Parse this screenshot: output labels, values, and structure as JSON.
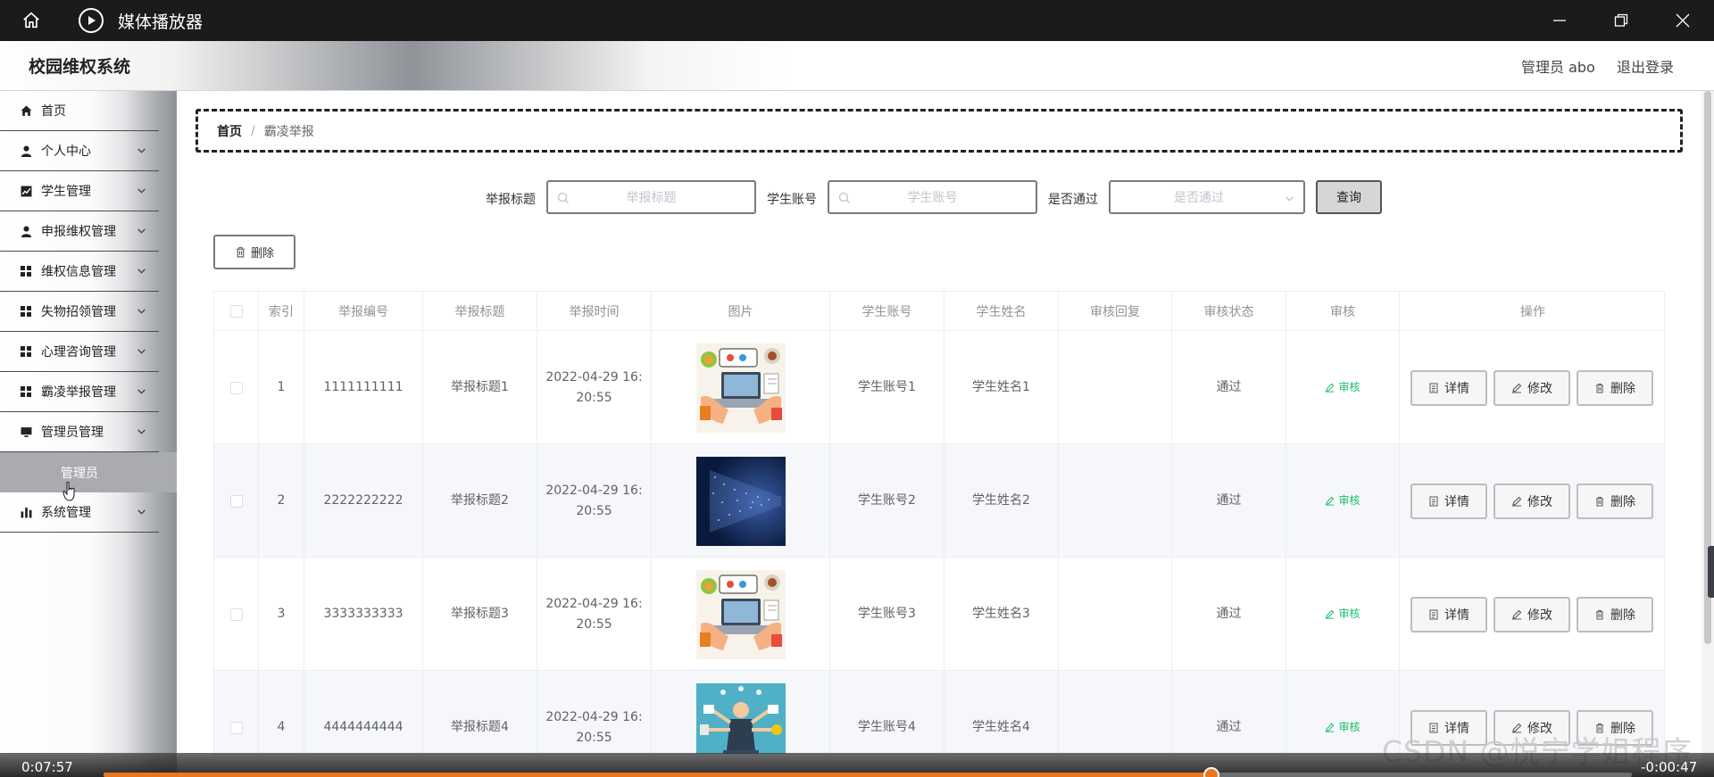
{
  "window": {
    "title": "媒体播放器"
  },
  "header": {
    "system_title": "校园维权系统",
    "admin_label": "管理员 abo",
    "logout_label": "退出登录"
  },
  "sidebar": {
    "items": [
      {
        "label": "首页",
        "icon": "home-icon",
        "expandable": false
      },
      {
        "label": "个人中心",
        "icon": "person-icon",
        "expandable": true
      },
      {
        "label": "学生管理",
        "icon": "chart-icon",
        "expandable": true
      },
      {
        "label": "申报维权管理",
        "icon": "person-icon",
        "expandable": true
      },
      {
        "label": "维权信息管理",
        "icon": "grid-icon",
        "expandable": true
      },
      {
        "label": "失物招领管理",
        "icon": "grid-icon",
        "expandable": true
      },
      {
        "label": "心理咨询管理",
        "icon": "grid-icon",
        "expandable": true
      },
      {
        "label": "霸凌举报管理",
        "icon": "grid-icon",
        "expandable": true
      },
      {
        "label": "管理员管理",
        "icon": "monitor-icon",
        "expandable": true
      },
      {
        "label": "系统管理",
        "icon": "bar-chart-icon",
        "expandable": true
      }
    ],
    "active_subitem": "管理员"
  },
  "breadcrumb": {
    "home": "首页",
    "separator": "/",
    "current": "霸凌举报"
  },
  "search": {
    "title_label": "举报标题",
    "title_placeholder": "举报标题",
    "account_label": "学生账号",
    "account_placeholder": "学生账号",
    "passed_label": "是否通过",
    "passed_placeholder": "是否通过",
    "query_button": "查询"
  },
  "toolbar": {
    "delete_label": "删除"
  },
  "table": {
    "columns": [
      "索引",
      "举报编号",
      "举报标题",
      "举报时间",
      "图片",
      "学生账号",
      "学生姓名",
      "审核回复",
      "审核状态",
      "审核",
      "操作"
    ],
    "rows": [
      {
        "index": "1",
        "number": "1111111111",
        "title": "举报标题1",
        "time_line1": "2022-04-29 16:",
        "time_line2": "20:55",
        "image": "office-illustration",
        "account": "学生账号1",
        "name": "学生姓名1",
        "reply": "",
        "status": "通过"
      },
      {
        "index": "2",
        "number": "2222222222",
        "title": "举报标题2",
        "time_line1": "2022-04-29 16:",
        "time_line2": "20:55",
        "image": "digital-data-image",
        "account": "学生账号2",
        "name": "学生姓名2",
        "reply": "",
        "status": "通过"
      },
      {
        "index": "3",
        "number": "3333333333",
        "title": "举报标题3",
        "time_line1": "2022-04-29 16:",
        "time_line2": "20:55",
        "image": "office-illustration",
        "account": "学生账号3",
        "name": "学生姓名3",
        "reply": "",
        "status": "通过"
      },
      {
        "index": "4",
        "number": "4444444444",
        "title": "举报标题4",
        "time_line1": "2022-04-29 16:",
        "time_line2": "20:55",
        "image": "multitask-illustration",
        "account": "学生账号4",
        "name": "学生姓名4",
        "reply": "",
        "status": "通过"
      }
    ],
    "audit_link": "审核",
    "actions": {
      "detail": "详情",
      "edit": "修改",
      "delete": "删除"
    }
  },
  "player": {
    "elapsed": "0:07:57",
    "remaining": "-0:00:47",
    "progress": 0.725
  },
  "watermark": "CSDN @悦宁学姐程序",
  "colors": {
    "accent_green": "#19be6b",
    "progress_orange": "#e8761f",
    "titlebar": "#1b1b1b"
  }
}
